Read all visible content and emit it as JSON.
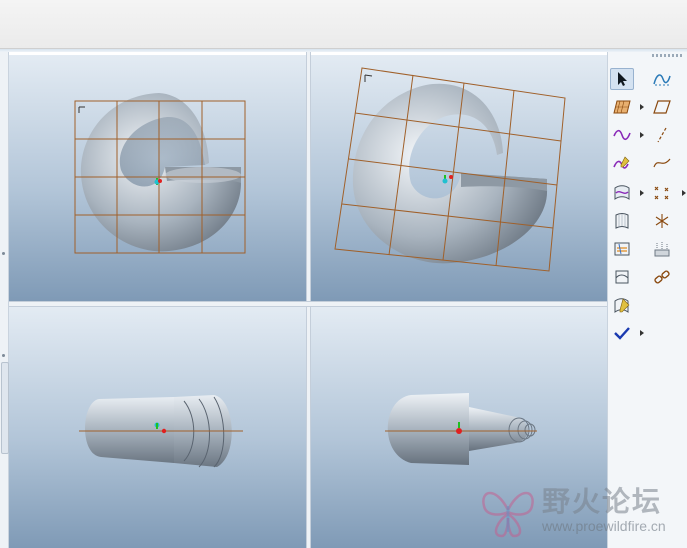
{
  "watermark": {
    "title": "野火论坛",
    "url": "www.proewildfire.cn"
  },
  "toolbar": {
    "buttons": [
      {
        "name": "select-icon",
        "active": true
      },
      {
        "name": "sketched-datum-curve-icon"
      },
      {
        "name": "datum-plane-grid-icon"
      },
      {
        "name": "datum-plane-icon"
      },
      {
        "name": "curve-wave-icon"
      },
      {
        "name": "datum-axis-icon"
      },
      {
        "name": "curve-edit-icon"
      },
      {
        "name": "spline-curve-icon"
      },
      {
        "name": "surface-curve-icon"
      },
      {
        "name": "datum-points-icon"
      },
      {
        "name": "boundary-surface-icon"
      },
      {
        "name": "coordinate-system-icon"
      },
      {
        "name": "surface-trim-icon"
      },
      {
        "name": "analysis-icon"
      },
      {
        "name": "surface-blend-icon"
      },
      {
        "name": "chain-link-icon"
      },
      {
        "name": "surface-edit-icon"
      },
      {
        "name": "done-check-icon"
      }
    ]
  },
  "colors": {
    "grid": "#a0602a",
    "model": "#b8c2cc",
    "viewport_top": "#e3ebf3",
    "viewport_bottom": "#7f9ab6",
    "axis_red": "#e02020",
    "axis_green": "#20c020",
    "axis_cyan": "#20c0d0"
  }
}
